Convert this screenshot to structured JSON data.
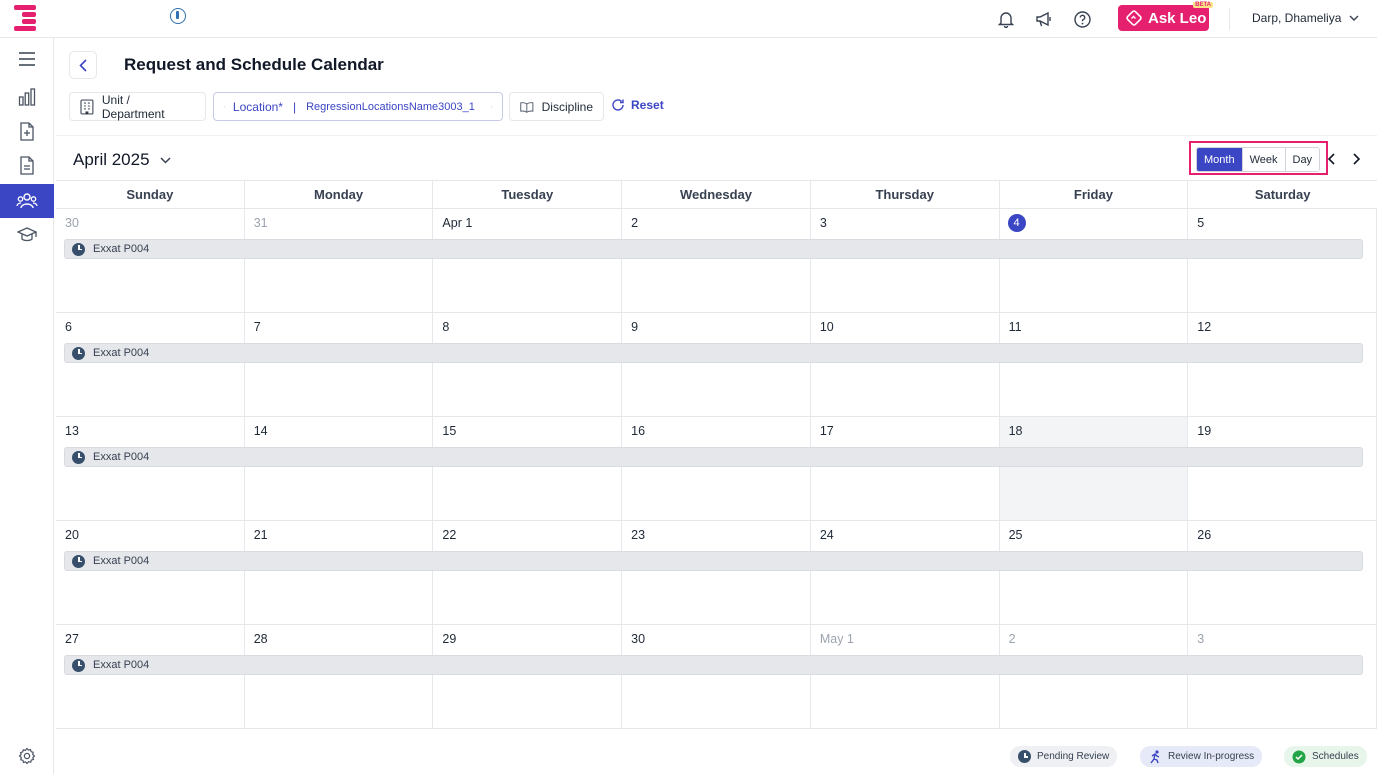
{
  "header": {
    "ask_leo_label": "Ask Leo",
    "beta_badge": "BETA",
    "user_name": "Darp, Dhameliya"
  },
  "page": {
    "title": "Request and Schedule Calendar"
  },
  "filters": {
    "unit_department": "Unit / Department",
    "location_label": "Location*",
    "location_separator": "|",
    "location_value": "RegressionLocationsName3003_1",
    "discipline": "Discipline",
    "reset": "Reset"
  },
  "calendar": {
    "month_label": "April 2025",
    "views": [
      "Month",
      "Week",
      "Day"
    ],
    "active_view": "Month",
    "weekdays": [
      "Sunday",
      "Monday",
      "Tuesday",
      "Wednesday",
      "Thursday",
      "Friday",
      "Saturday"
    ],
    "weeks": [
      {
        "days": [
          "30",
          "31",
          "Apr 1",
          "2",
          "3",
          "4",
          "5"
        ],
        "event": "Exxat P004"
      },
      {
        "days": [
          "6",
          "7",
          "8",
          "9",
          "10",
          "11",
          "12"
        ],
        "event": "Exxat P004"
      },
      {
        "days": [
          "13",
          "14",
          "15",
          "16",
          "17",
          "18",
          "19"
        ],
        "event": "Exxat P004"
      },
      {
        "days": [
          "20",
          "21",
          "22",
          "23",
          "24",
          "25",
          "26"
        ],
        "event": "Exxat P004"
      },
      {
        "days": [
          "27",
          "28",
          "29",
          "30",
          "May 1",
          "2",
          "3"
        ],
        "event": "Exxat P004"
      }
    ],
    "today_label": "4"
  },
  "legend": {
    "pending_review": "Pending Review",
    "review_in_progress": "Review In-progress",
    "schedules": "Schedules"
  },
  "colors": {
    "brand_pink": "#e5206f",
    "primary_blue": "#3b46c4"
  }
}
